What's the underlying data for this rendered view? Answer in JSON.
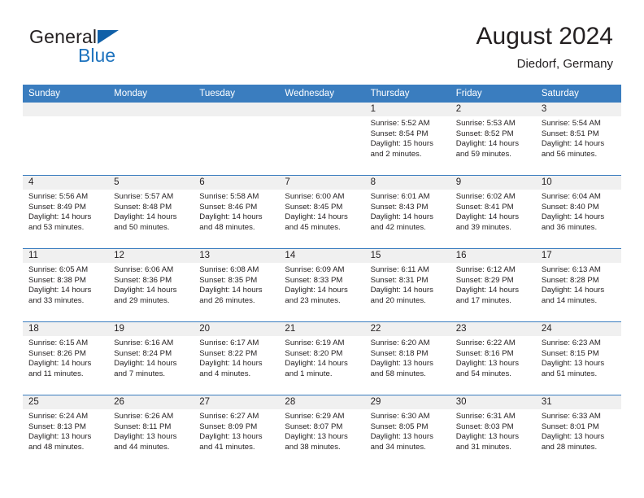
{
  "brand": {
    "name_top": "General",
    "name_bottom": "Blue",
    "triangle_color": "#1060a8",
    "blue_color": "#1e73be"
  },
  "header": {
    "title": "August 2024",
    "subtitle": "Diedorf, Germany"
  },
  "colors": {
    "header_blue": "#3a7dbf",
    "day_band_gray": "#f0f0f0",
    "text": "#231f20"
  },
  "weekdays": [
    "Sunday",
    "Monday",
    "Tuesday",
    "Wednesday",
    "Thursday",
    "Friday",
    "Saturday"
  ],
  "weeks": [
    [
      {
        "day": "",
        "empty": true
      },
      {
        "day": "",
        "empty": true
      },
      {
        "day": "",
        "empty": true
      },
      {
        "day": "",
        "empty": true
      },
      {
        "day": "1",
        "sunrise": "Sunrise: 5:52 AM",
        "sunset": "Sunset: 8:54 PM",
        "daylight1": "Daylight: 15 hours",
        "daylight2": "and 2 minutes."
      },
      {
        "day": "2",
        "sunrise": "Sunrise: 5:53 AM",
        "sunset": "Sunset: 8:52 PM",
        "daylight1": "Daylight: 14 hours",
        "daylight2": "and 59 minutes."
      },
      {
        "day": "3",
        "sunrise": "Sunrise: 5:54 AM",
        "sunset": "Sunset: 8:51 PM",
        "daylight1": "Daylight: 14 hours",
        "daylight2": "and 56 minutes."
      }
    ],
    [
      {
        "day": "4",
        "sunrise": "Sunrise: 5:56 AM",
        "sunset": "Sunset: 8:49 PM",
        "daylight1": "Daylight: 14 hours",
        "daylight2": "and 53 minutes."
      },
      {
        "day": "5",
        "sunrise": "Sunrise: 5:57 AM",
        "sunset": "Sunset: 8:48 PM",
        "daylight1": "Daylight: 14 hours",
        "daylight2": "and 50 minutes."
      },
      {
        "day": "6",
        "sunrise": "Sunrise: 5:58 AM",
        "sunset": "Sunset: 8:46 PM",
        "daylight1": "Daylight: 14 hours",
        "daylight2": "and 48 minutes."
      },
      {
        "day": "7",
        "sunrise": "Sunrise: 6:00 AM",
        "sunset": "Sunset: 8:45 PM",
        "daylight1": "Daylight: 14 hours",
        "daylight2": "and 45 minutes."
      },
      {
        "day": "8",
        "sunrise": "Sunrise: 6:01 AM",
        "sunset": "Sunset: 8:43 PM",
        "daylight1": "Daylight: 14 hours",
        "daylight2": "and 42 minutes."
      },
      {
        "day": "9",
        "sunrise": "Sunrise: 6:02 AM",
        "sunset": "Sunset: 8:41 PM",
        "daylight1": "Daylight: 14 hours",
        "daylight2": "and 39 minutes."
      },
      {
        "day": "10",
        "sunrise": "Sunrise: 6:04 AM",
        "sunset": "Sunset: 8:40 PM",
        "daylight1": "Daylight: 14 hours",
        "daylight2": "and 36 minutes."
      }
    ],
    [
      {
        "day": "11",
        "sunrise": "Sunrise: 6:05 AM",
        "sunset": "Sunset: 8:38 PM",
        "daylight1": "Daylight: 14 hours",
        "daylight2": "and 33 minutes."
      },
      {
        "day": "12",
        "sunrise": "Sunrise: 6:06 AM",
        "sunset": "Sunset: 8:36 PM",
        "daylight1": "Daylight: 14 hours",
        "daylight2": "and 29 minutes."
      },
      {
        "day": "13",
        "sunrise": "Sunrise: 6:08 AM",
        "sunset": "Sunset: 8:35 PM",
        "daylight1": "Daylight: 14 hours",
        "daylight2": "and 26 minutes."
      },
      {
        "day": "14",
        "sunrise": "Sunrise: 6:09 AM",
        "sunset": "Sunset: 8:33 PM",
        "daylight1": "Daylight: 14 hours",
        "daylight2": "and 23 minutes."
      },
      {
        "day": "15",
        "sunrise": "Sunrise: 6:11 AM",
        "sunset": "Sunset: 8:31 PM",
        "daylight1": "Daylight: 14 hours",
        "daylight2": "and 20 minutes."
      },
      {
        "day": "16",
        "sunrise": "Sunrise: 6:12 AM",
        "sunset": "Sunset: 8:29 PM",
        "daylight1": "Daylight: 14 hours",
        "daylight2": "and 17 minutes."
      },
      {
        "day": "17",
        "sunrise": "Sunrise: 6:13 AM",
        "sunset": "Sunset: 8:28 PM",
        "daylight1": "Daylight: 14 hours",
        "daylight2": "and 14 minutes."
      }
    ],
    [
      {
        "day": "18",
        "sunrise": "Sunrise: 6:15 AM",
        "sunset": "Sunset: 8:26 PM",
        "daylight1": "Daylight: 14 hours",
        "daylight2": "and 11 minutes."
      },
      {
        "day": "19",
        "sunrise": "Sunrise: 6:16 AM",
        "sunset": "Sunset: 8:24 PM",
        "daylight1": "Daylight: 14 hours",
        "daylight2": "and 7 minutes."
      },
      {
        "day": "20",
        "sunrise": "Sunrise: 6:17 AM",
        "sunset": "Sunset: 8:22 PM",
        "daylight1": "Daylight: 14 hours",
        "daylight2": "and 4 minutes."
      },
      {
        "day": "21",
        "sunrise": "Sunrise: 6:19 AM",
        "sunset": "Sunset: 8:20 PM",
        "daylight1": "Daylight: 14 hours",
        "daylight2": "and 1 minute."
      },
      {
        "day": "22",
        "sunrise": "Sunrise: 6:20 AM",
        "sunset": "Sunset: 8:18 PM",
        "daylight1": "Daylight: 13 hours",
        "daylight2": "and 58 minutes."
      },
      {
        "day": "23",
        "sunrise": "Sunrise: 6:22 AM",
        "sunset": "Sunset: 8:16 PM",
        "daylight1": "Daylight: 13 hours",
        "daylight2": "and 54 minutes."
      },
      {
        "day": "24",
        "sunrise": "Sunrise: 6:23 AM",
        "sunset": "Sunset: 8:15 PM",
        "daylight1": "Daylight: 13 hours",
        "daylight2": "and 51 minutes."
      }
    ],
    [
      {
        "day": "25",
        "sunrise": "Sunrise: 6:24 AM",
        "sunset": "Sunset: 8:13 PM",
        "daylight1": "Daylight: 13 hours",
        "daylight2": "and 48 minutes."
      },
      {
        "day": "26",
        "sunrise": "Sunrise: 6:26 AM",
        "sunset": "Sunset: 8:11 PM",
        "daylight1": "Daylight: 13 hours",
        "daylight2": "and 44 minutes."
      },
      {
        "day": "27",
        "sunrise": "Sunrise: 6:27 AM",
        "sunset": "Sunset: 8:09 PM",
        "daylight1": "Daylight: 13 hours",
        "daylight2": "and 41 minutes."
      },
      {
        "day": "28",
        "sunrise": "Sunrise: 6:29 AM",
        "sunset": "Sunset: 8:07 PM",
        "daylight1": "Daylight: 13 hours",
        "daylight2": "and 38 minutes."
      },
      {
        "day": "29",
        "sunrise": "Sunrise: 6:30 AM",
        "sunset": "Sunset: 8:05 PM",
        "daylight1": "Daylight: 13 hours",
        "daylight2": "and 34 minutes."
      },
      {
        "day": "30",
        "sunrise": "Sunrise: 6:31 AM",
        "sunset": "Sunset: 8:03 PM",
        "daylight1": "Daylight: 13 hours",
        "daylight2": "and 31 minutes."
      },
      {
        "day": "31",
        "sunrise": "Sunrise: 6:33 AM",
        "sunset": "Sunset: 8:01 PM",
        "daylight1": "Daylight: 13 hours",
        "daylight2": "and 28 minutes."
      }
    ]
  ]
}
